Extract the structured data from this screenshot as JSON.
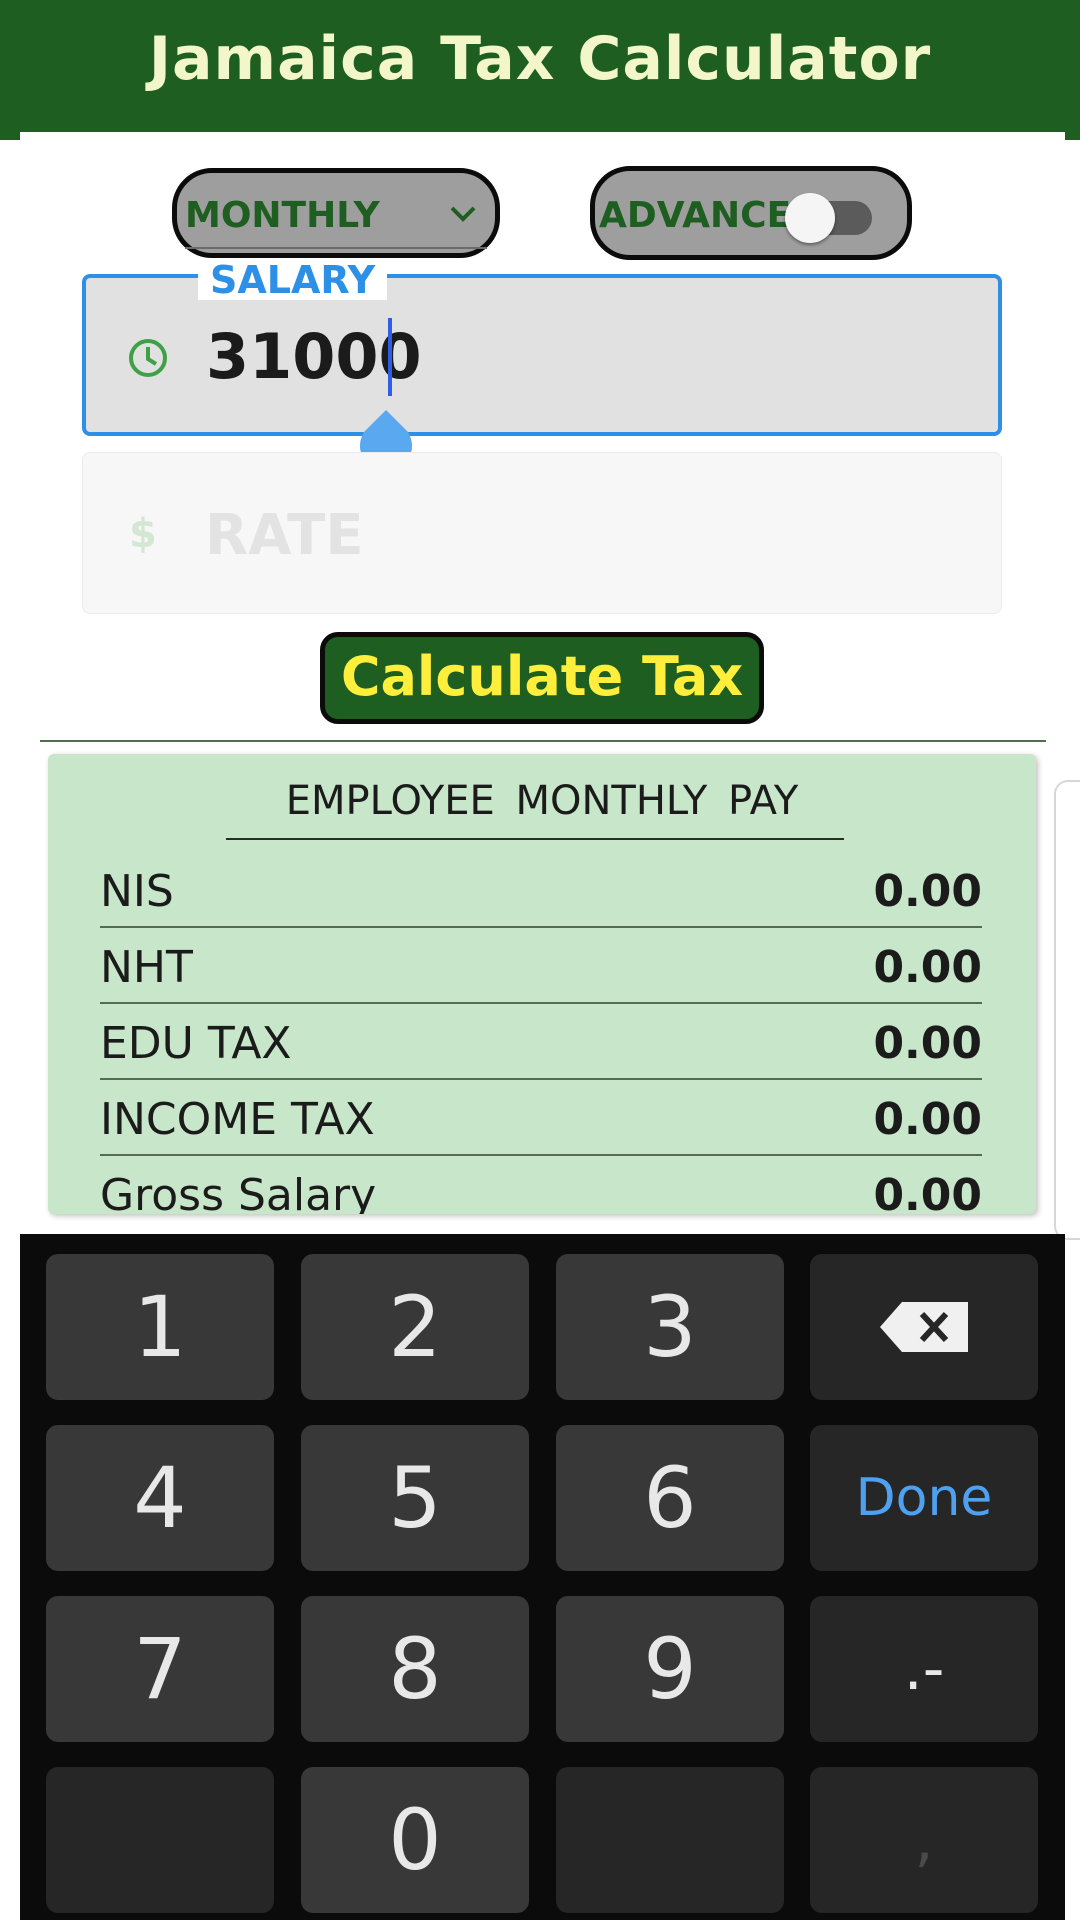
{
  "app": {
    "title": "Jamaica Tax Calculator"
  },
  "controls": {
    "period": "MONTHLY",
    "advance_label": "ADVANCE",
    "advance_on": false
  },
  "salary": {
    "label": "SALARY",
    "value": "31000"
  },
  "rate": {
    "placeholder": "RATE",
    "icon": "$"
  },
  "calculate_label": "Calculate Tax",
  "results": {
    "header": "EMPLOYEE MONTHLY PAY",
    "rows": [
      {
        "name": "NIS",
        "value": "0.00"
      },
      {
        "name": "NHT",
        "value": "0.00"
      },
      {
        "name": "EDU TAX",
        "value": "0.00"
      },
      {
        "name": "INCOME TAX",
        "value": "0.00"
      },
      {
        "name": "Gross Salary",
        "value": "0.00"
      }
    ]
  },
  "keyboard": {
    "keys": [
      "1",
      "2",
      "3",
      "4",
      "5",
      "6",
      "7",
      "8",
      "9",
      "0"
    ],
    "done": "Done",
    "punct": ".-",
    "comma": ","
  },
  "colors": {
    "brand_green": "#1e5e20",
    "title_text": "#f3f6c9",
    "button_text": "#ffef3c",
    "focus_blue": "#2e8fe6",
    "result_bg": "#c8e6c9"
  }
}
